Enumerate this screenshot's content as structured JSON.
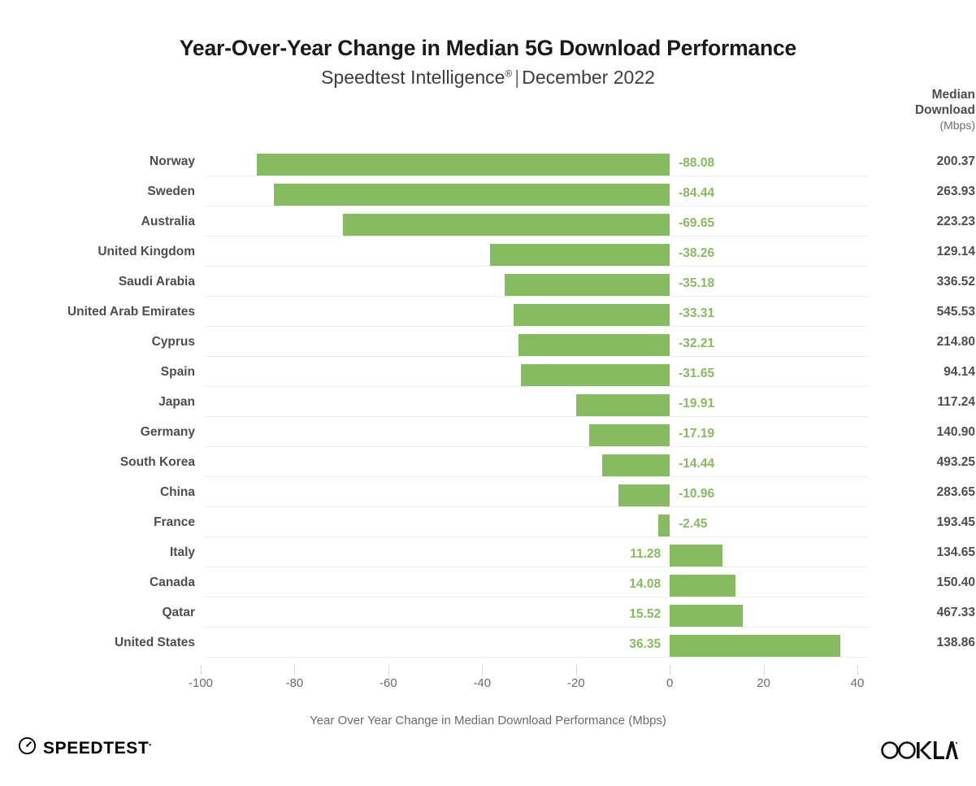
{
  "header": {
    "title": "Year-Over-Year Change in Median 5G Download Performance",
    "subtitle_source": "Speedtest Intelligence",
    "subtitle_registered": "®",
    "subtitle_divider": "|",
    "subtitle_period": "December 2022"
  },
  "right_column": {
    "header_line1": "Median",
    "header_line2": "Download",
    "header_unit": "(Mbps)"
  },
  "footer": {
    "speedtest_logo_text": "SPEEDTEST",
    "speedtest_logo_tm": "•",
    "ookla_logo_text": "OOKLA"
  },
  "colors": {
    "bar_green": "#86bb5f",
    "label_text": "#4d4d4d",
    "axis_text": "#6b6b6b",
    "gridline": "#ececec",
    "title_text": "#1a1a1a"
  },
  "chart_data": {
    "type": "bar",
    "orientation": "horizontal",
    "title": "Year-Over-Year Change in Median 5G Download Performance",
    "subtitle": "Speedtest Intelligence® | December 2022",
    "xlabel": "Year Over Year Change in Median Download Performance (Mbps)",
    "ylabel": "",
    "xlim": [
      -100,
      40
    ],
    "xticks": [
      -100,
      -80,
      -60,
      -40,
      -20,
      0,
      20,
      40
    ],
    "xtick_labels": [
      "-100",
      "-80",
      "-60",
      "-40",
      "-20",
      "0",
      "20",
      "40"
    ],
    "grid": "horizontal-row-baselines",
    "legend": "none",
    "series_name": "Year Over Year Change in Median Download Performance (Mbps)",
    "categories": [
      "Norway",
      "Sweden",
      "Australia",
      "United Kingdom",
      "Saudi Arabia",
      "United Arab Emirates",
      "Cyprus",
      "Spain",
      "Japan",
      "Germany",
      "South Korea",
      "China",
      "France",
      "Italy",
      "Canada",
      "Qatar",
      "United States"
    ],
    "values": [
      -88.08,
      -84.44,
      -69.65,
      -38.26,
      -35.18,
      -33.31,
      -32.21,
      -31.65,
      -19.91,
      -17.19,
      -14.44,
      -10.96,
      -2.45,
      11.28,
      14.08,
      15.52,
      36.35
    ],
    "value_labels": [
      "-88.08",
      "-84.44",
      "-69.65",
      "-38.26",
      "-35.18",
      "-33.31",
      "-32.21",
      "-31.65",
      "-19.91",
      "-17.19",
      "-14.44",
      "-10.96",
      "-2.45",
      "11.28",
      "14.08",
      "15.52",
      "36.35"
    ],
    "secondary_column": {
      "name": "Median Download (Mbps)",
      "values": [
        "200.37",
        "263.93",
        "223.23",
        "129.14",
        "336.52",
        "545.53",
        "214.80",
        "94.14",
        "117.24",
        "140.90",
        "493.25",
        "283.65",
        "193.45",
        "134.65",
        "150.40",
        "467.33",
        "138.86"
      ]
    }
  }
}
